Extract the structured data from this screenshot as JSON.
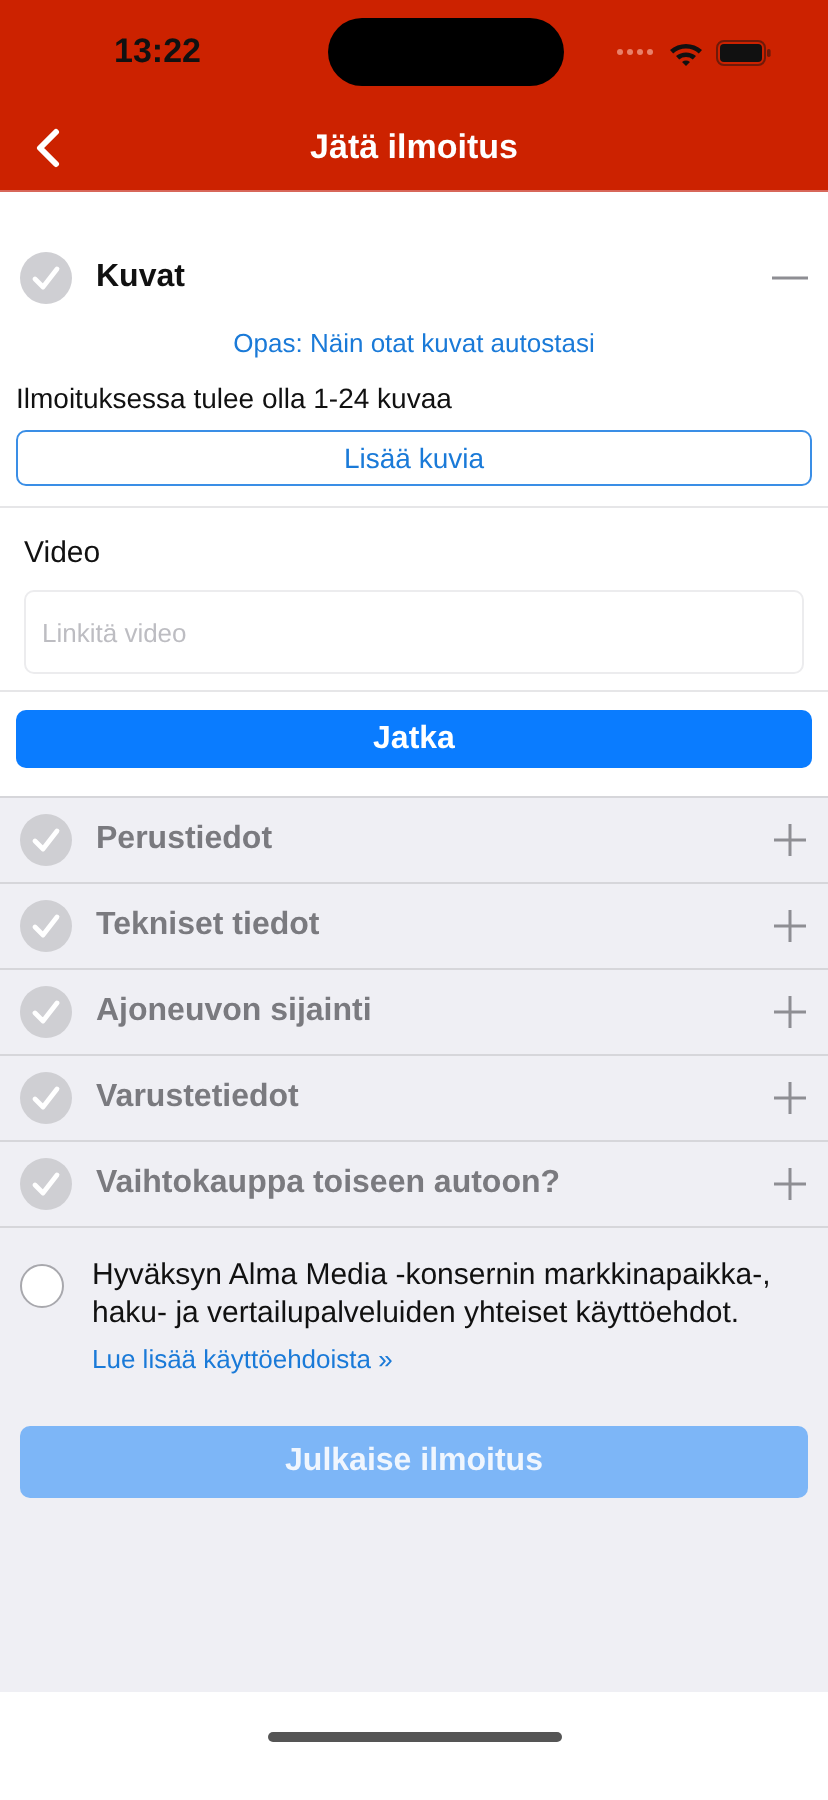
{
  "status_bar": {
    "time": "13:22"
  },
  "nav": {
    "title": "Jätä ilmoitus"
  },
  "sections": [
    {
      "title": "Kuvat",
      "completed": false,
      "expanded": true,
      "guide_link": "Opas: Näin otat kuvat autostasi",
      "hint": "Ilmoituksessa tulee olla 1-24 kuvaa",
      "add_button": "Lisää kuvia",
      "video_label": "Video",
      "video_placeholder": "Linkitä video",
      "continue_button": "Jatka"
    },
    {
      "title": "Perustiedot",
      "completed": false,
      "expanded": false
    },
    {
      "title": "Tekniset tiedot",
      "completed": false,
      "expanded": false
    },
    {
      "title": "Ajoneuvon sijainti",
      "completed": false,
      "expanded": false
    },
    {
      "title": "Varustetiedot",
      "completed": false,
      "expanded": false
    },
    {
      "title": "Vaihtokauppa toiseen autoon?",
      "completed": false,
      "expanded": false
    }
  ],
  "terms": {
    "checked": false,
    "text": "Hyväksyn Alma Media -konsernin markkinapaikka-, haku- ja vertailupalveluiden yhteiset käyttöehdot.",
    "link": "Lue lisää käyttöehdoista »"
  },
  "publish_button": {
    "label": "Julkaise ilmoitus",
    "disabled": true
  }
}
